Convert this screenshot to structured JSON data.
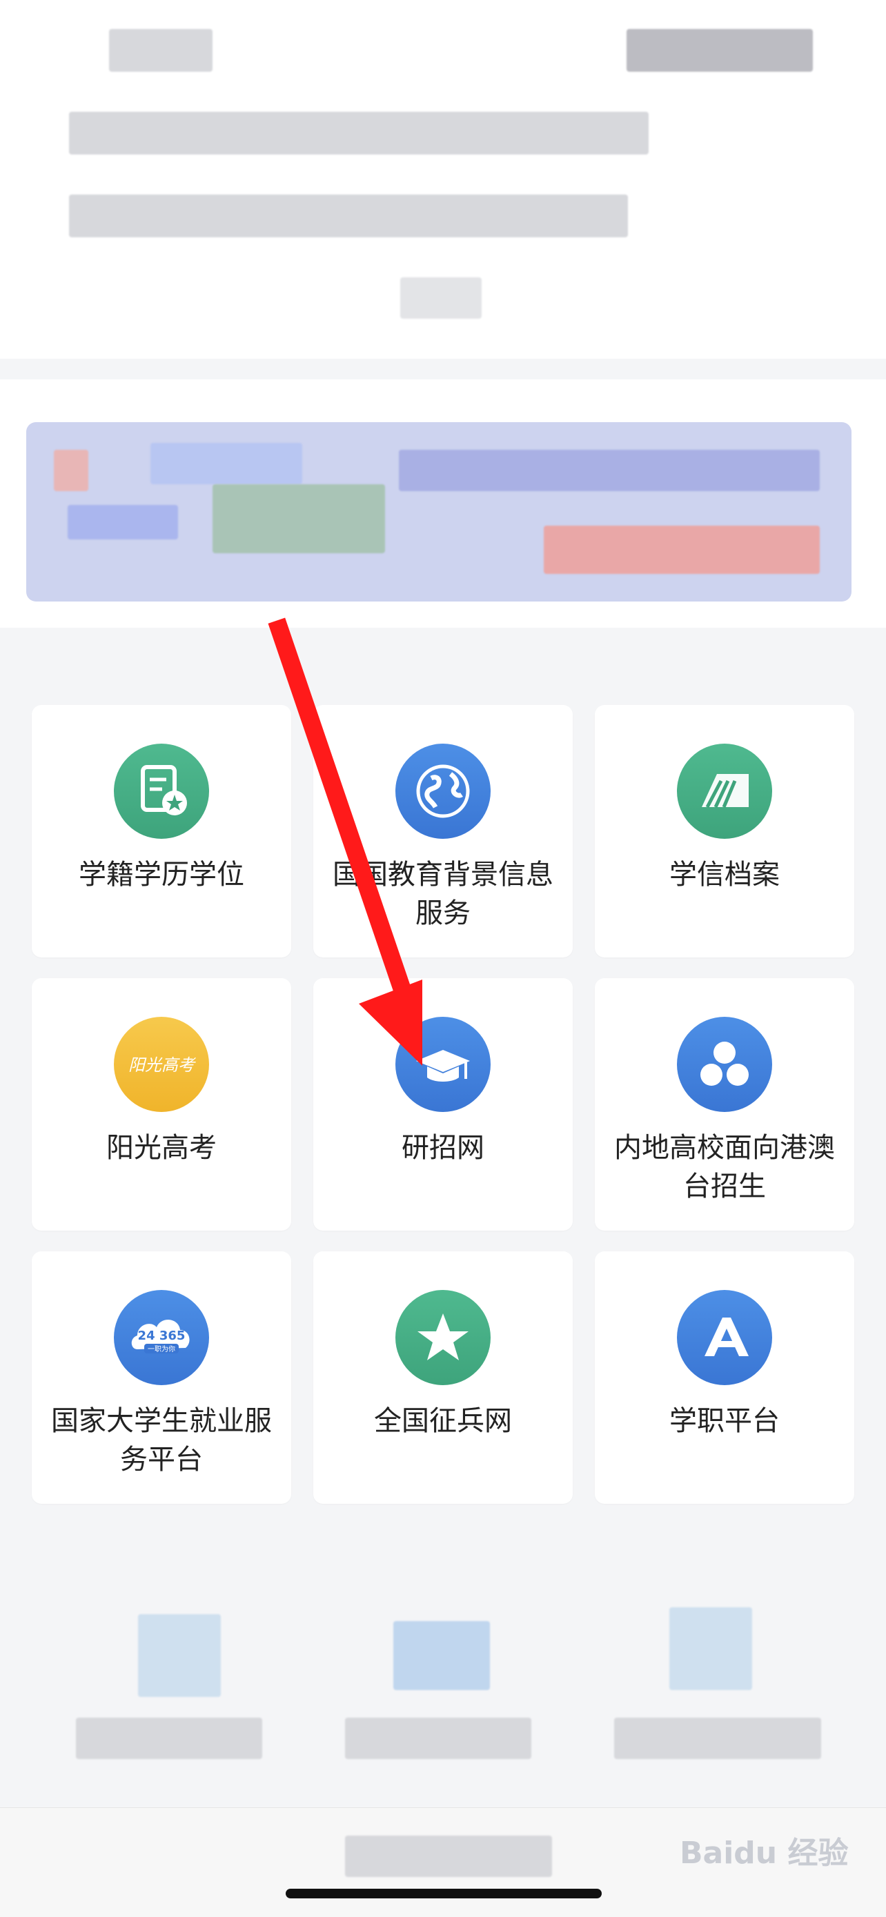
{
  "grid": {
    "items": [
      {
        "label": "学籍学历学位",
        "icon": "student-record-icon",
        "color": "green"
      },
      {
        "label": "国国教育背景信息服务",
        "icon": "globe-icon",
        "color": "blue"
      },
      {
        "label": "学信档案",
        "icon": "archive-icon",
        "color": "green"
      },
      {
        "label": "阳光高考",
        "icon": "sunshine-gaokao-icon",
        "color": "yellow",
        "icon_text": "阳光高考"
      },
      {
        "label": "研招网",
        "icon": "graduation-cap-icon",
        "color": "blue"
      },
      {
        "label": "内地高校面向港澳台招生",
        "icon": "three-circles-icon",
        "color": "blue"
      },
      {
        "label": "国家大学生就业服务平台",
        "icon": "cloud-24365-icon",
        "color": "blue",
        "icon_text_top": "24 365",
        "icon_text_bottom": "一职为你"
      },
      {
        "label": "全国征兵网",
        "icon": "star-icon",
        "color": "green"
      },
      {
        "label": "学职平台",
        "icon": "a-logo-icon",
        "color": "blue"
      }
    ]
  },
  "watermark": "Baidu 经验"
}
